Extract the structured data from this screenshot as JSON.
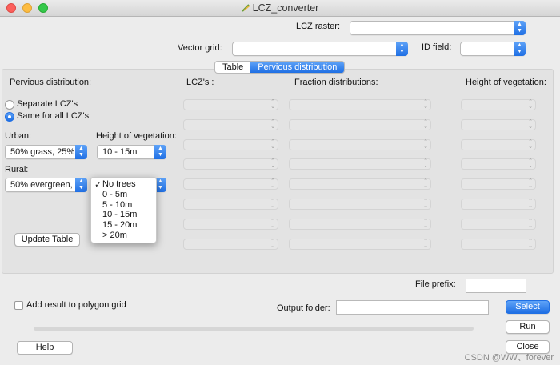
{
  "window": {
    "title": "LCZ_converter"
  },
  "top": {
    "lcz_raster_label": "LCZ raster:",
    "vector_grid_label": "Vector grid:",
    "id_field_label": "ID field:"
  },
  "tabs": [
    {
      "label": "Table",
      "active": false
    },
    {
      "label": "Pervious distribution",
      "active": true
    }
  ],
  "panel": {
    "pervious_distribution_label": "Pervious distribution:",
    "lczs_header": "LCZ's :",
    "fraction_header": "Fraction distributions:",
    "height_header": "Height of vegetation:",
    "radio_separate": "Separate LCZ's",
    "radio_same": "Same for all LCZ's",
    "urban_label": "Urban:",
    "height_label": "Height of vegetation:",
    "urban_value": "50% grass, 25%",
    "height_value": "10 - 15m",
    "rural_label": "Rural:",
    "rural_value": "50% evergreen,",
    "update_table_button": "Update Table"
  },
  "height_dropdown": {
    "selected": "No trees",
    "check": "✓",
    "options": [
      "No trees",
      "0 - 5m",
      "5 - 10m",
      "10 - 15m",
      "15 - 20m",
      "> 20m"
    ]
  },
  "bottom": {
    "file_prefix_label": "File prefix:",
    "add_result_label": "Add result to polygon grid",
    "output_folder_label": "Output folder:",
    "select_button": "Select",
    "run_button": "Run",
    "help_button": "Help",
    "close_button": "Close"
  },
  "watermark": "CSDN @WW、forever",
  "colors": {
    "accent": "#1f6fe4",
    "panel": "#e3e3e3",
    "window": "#ececec"
  }
}
